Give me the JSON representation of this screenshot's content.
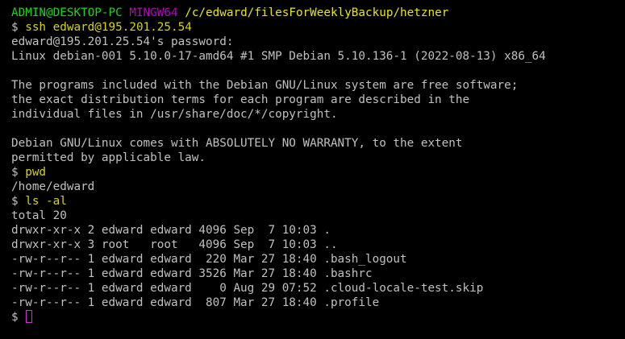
{
  "prompt_header": {
    "user_host": "ADMIN@DESKTOP-PC",
    "shell": "MINGW64",
    "path": "/c/edward/filesForWeeklyBackup/hetzner"
  },
  "prompt_symbol": "$ ",
  "commands": {
    "ssh": "ssh edward@195.201.25.54",
    "pwd": "pwd",
    "ls": "ls -al"
  },
  "output": {
    "password_prompt": "edward@195.201.25.54's password:",
    "uname": "Linux debian-001 5.10.0-17-amd64 #1 SMP Debian 5.10.136-1 (2022-08-13) x86_64",
    "motd": [
      "The programs included with the Debian GNU/Linux system are free software;",
      "the exact distribution terms for each program are described in the",
      "individual files in /usr/share/doc/*/copyright.",
      "Debian GNU/Linux comes with ABSOLUTELY NO WARRANTY, to the extent",
      "permitted by applicable law."
    ],
    "pwd_result": "/home/edward",
    "ls_total": "total 20",
    "ls_rows": [
      "drwxr-xr-x 2 edward edward 4096 Sep  7 10:03 .",
      "drwxr-xr-x 3 root   root   4096 Sep  7 10:03 ..",
      "-rw-r--r-- 1 edward edward  220 Mar 27 18:40 .bash_logout",
      "-rw-r--r-- 1 edward edward 3526 Mar 27 18:40 .bashrc",
      "-rw-r--r-- 1 edward edward    0 Aug 29 07:52 .cloud-locale-test.skip",
      "-rw-r--r-- 1 edward edward  807 Mar 27 18:40 .profile"
    ]
  },
  "colors": {
    "background": "#000000",
    "foreground": "#c0c0c0",
    "user_host": "#1fd11f",
    "shell": "#c000c0",
    "path": "#e5e514",
    "command": "#d4d414",
    "cursor": "#d030d0"
  }
}
